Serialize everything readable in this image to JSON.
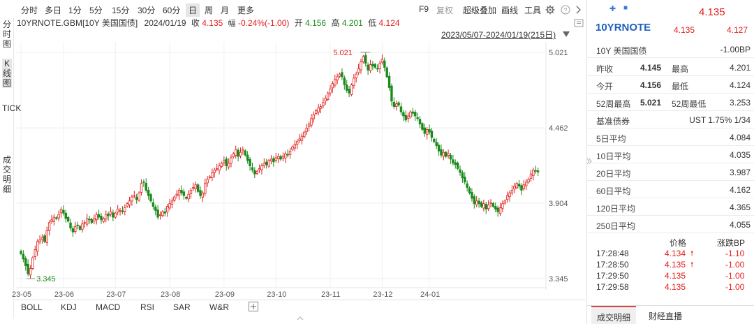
{
  "toolbar": {
    "tabs": [
      "分时",
      "多日",
      "1分",
      "5分",
      "15分",
      "30分",
      "60分",
      "日",
      "周",
      "月",
      "更多"
    ],
    "active_tab": "日",
    "right": [
      "F9",
      "复权",
      "超级叠加",
      "画线",
      "工具"
    ]
  },
  "lefttabs": {
    "fenshitu": "分时图",
    "kxiantu": "K线图",
    "tick": "TICK",
    "chengjiao": "成交明细"
  },
  "info": {
    "symbol": "10YRNOTE.GBM[10Y 美国国债]",
    "date": "2024/01/19",
    "close_label": "收",
    "close": "4.135",
    "change_label": "幅",
    "change": "-0.24%(-1.00)",
    "open_label": "开",
    "open": "4.156",
    "high_label": "高",
    "high": "4.201",
    "low_label": "低",
    "low": "4.124"
  },
  "range_text": "2023/05/07-2024/01/19(215日)",
  "indicators": [
    "BOLL",
    "KDJ",
    "MACD",
    "RSI",
    "SAR",
    "W&R"
  ],
  "panel": {
    "price_top": "4.135",
    "code": "10YRNOTE",
    "last": "4.135",
    "other": "4.127",
    "name": "10Y 美国国债",
    "change_bp": "-1.00BP",
    "rows": [
      {
        "l1": "昨收",
        "v1": "4.145",
        "l2": "最高",
        "v2": "4.201"
      },
      {
        "l1": "今开",
        "v1": "4.156",
        "l2": "最低",
        "v2": "4.124"
      },
      {
        "l1": "52周最高",
        "v1": "5.021",
        "l2": "52周最低",
        "v2": "3.253"
      }
    ],
    "bench_label": "基准债券",
    "bench_value": "UST 1.75% 1/34",
    "averages": [
      {
        "label": "5日平均",
        "value": "4.084"
      },
      {
        "label": "10日平均",
        "value": "4.035"
      },
      {
        "label": "20日平均",
        "value": "3.987"
      },
      {
        "label": "60日平均",
        "value": "4.162"
      },
      {
        "label": "120日平均",
        "value": "4.365"
      },
      {
        "label": "250日平均",
        "value": "4.055"
      }
    ],
    "tick_header": {
      "price": "价格",
      "change": "涨跌BP"
    },
    "ticks": [
      {
        "time": "17:28:48",
        "price": "4.134",
        "arrow": "🠕",
        "chg": "-1.10"
      },
      {
        "time": "17:28:50",
        "price": "4.135",
        "arrow": "🠕",
        "chg": "-1.00"
      },
      {
        "time": "17:29:50",
        "price": "4.135",
        "arrow": "",
        "chg": "-1.00"
      },
      {
        "time": "17:29:58",
        "price": "4.135",
        "arrow": "",
        "chg": "-1.00"
      }
    ],
    "bottom_tabs": [
      "成交明细",
      "财经直播"
    ]
  },
  "chart_data": {
    "type": "candlestick",
    "y_ticks": [
      5.021,
      4.462,
      3.904,
      3.345
    ],
    "x_ticks": [
      "23-05",
      "23-06",
      "23-07",
      "23-08",
      "23-09",
      "23-10",
      "23-11",
      "23-12",
      "24-01"
    ],
    "ylim": [
      3.345,
      5.021
    ],
    "max_label": "5.021",
    "min_label": "3.345",
    "up_color": "#e1201e",
    "down_color": "#1a8a1a",
    "close_path": [
      3.53,
      3.49,
      3.44,
      3.38,
      3.42,
      3.5,
      3.56,
      3.62,
      3.63,
      3.65,
      3.62,
      3.7,
      3.76,
      3.78,
      3.8,
      3.79,
      3.82,
      3.86,
      3.83,
      3.79,
      3.77,
      3.72,
      3.69,
      3.73,
      3.74,
      3.71,
      3.75,
      3.76,
      3.79,
      3.78,
      3.76,
      3.79,
      3.82,
      3.8,
      3.78,
      3.79,
      3.82,
      3.81,
      3.84,
      3.8,
      3.83,
      3.86,
      3.85,
      3.84,
      3.87,
      3.9,
      3.92,
      3.95,
      3.96,
      3.93,
      3.98,
      4.05,
      4.06,
      4.0,
      3.96,
      3.92,
      3.88,
      3.85,
      3.8,
      3.82,
      3.84,
      3.83,
      3.88,
      3.9,
      3.92,
      3.95,
      3.97,
      4.0,
      3.98,
      3.96,
      3.94,
      3.97,
      4.0,
      4.02,
      4.04,
      3.99,
      3.96,
      3.98,
      4.05,
      4.08,
      4.1,
      4.13,
      4.15,
      4.16,
      4.18,
      4.2,
      4.22,
      4.18,
      4.2,
      4.24,
      4.27,
      4.3,
      4.25,
      4.28,
      4.3,
      4.26,
      4.22,
      4.18,
      4.15,
      4.12,
      4.14,
      4.16,
      4.18,
      4.2,
      4.19,
      4.22,
      4.23,
      4.21,
      4.24,
      4.25,
      4.23,
      4.25,
      4.27,
      4.26,
      4.29,
      4.32,
      4.34,
      4.36,
      4.38,
      4.4,
      4.43,
      4.46,
      4.49,
      4.53,
      4.56,
      4.59,
      4.61,
      4.62,
      4.65,
      4.68,
      4.72,
      4.75,
      4.79,
      4.82,
      4.84,
      4.86,
      4.84,
      4.78,
      4.74,
      4.72,
      4.78,
      4.83,
      4.86,
      4.9,
      4.95,
      4.99,
      4.94,
      4.89,
      4.93,
      4.92,
      4.91,
      4.9,
      4.94,
      4.97,
      4.91,
      4.84,
      4.76,
      4.66,
      4.62,
      4.64,
      4.63,
      4.58,
      4.55,
      4.52,
      4.55,
      4.58,
      4.57,
      4.55,
      4.53,
      4.49,
      4.45,
      4.42,
      4.45,
      4.43,
      4.39,
      4.36,
      4.33,
      4.29,
      4.26,
      4.28,
      4.25,
      4.27,
      4.23,
      4.2,
      4.19,
      4.16,
      4.13,
      4.09,
      4.06,
      4.02,
      3.98,
      3.94,
      3.9,
      3.92,
      3.9,
      3.88,
      3.9,
      3.86,
      3.89,
      3.91,
      3.88,
      3.86,
      3.84,
      3.87,
      3.9,
      3.92,
      3.96,
      3.98,
      4.0,
      4.03,
      4.05,
      4.03,
      4.0,
      4.04,
      4.06,
      4.08,
      4.12,
      4.15,
      4.14,
      4.135
    ]
  }
}
